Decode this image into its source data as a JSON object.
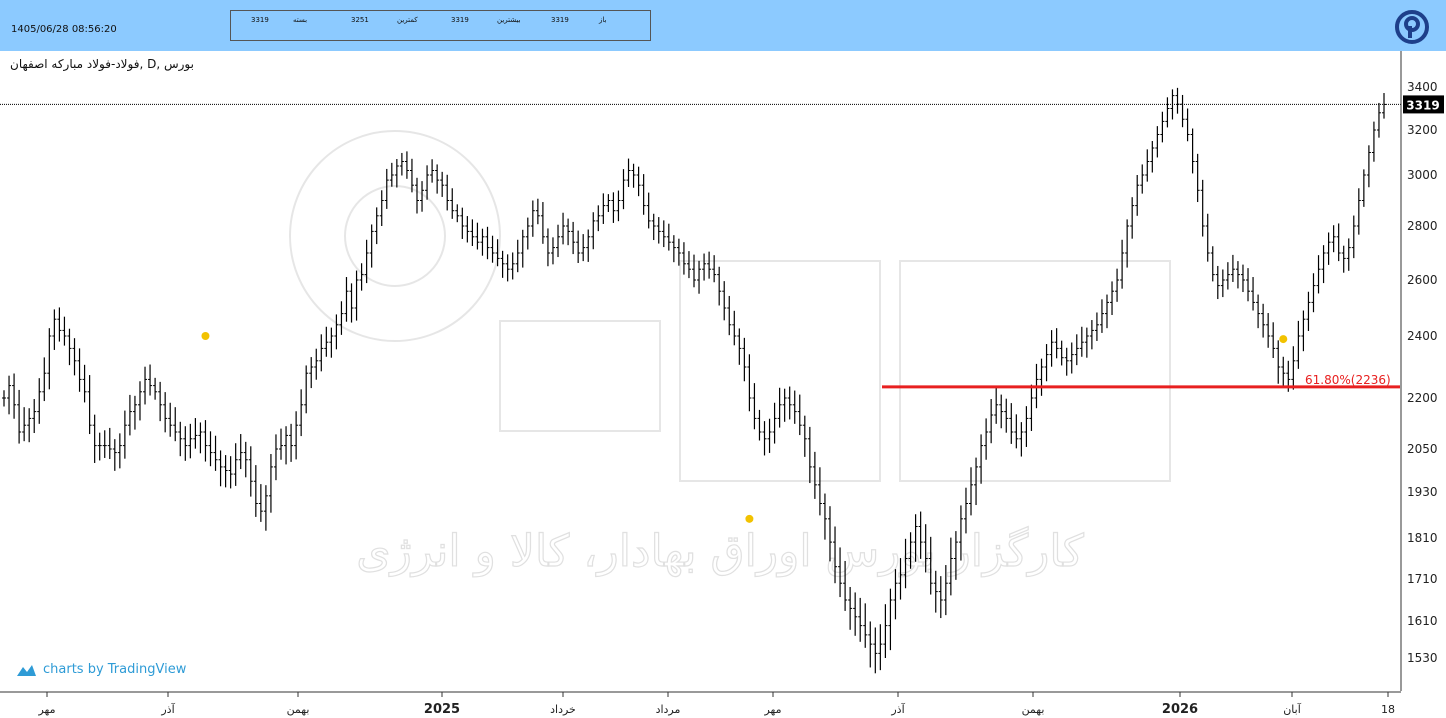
{
  "header": {
    "datetime": "1405/06/28 08:56:20",
    "info": [
      {
        "label": "باز",
        "value": "3319"
      },
      {
        "label": "بیشترین",
        "value": "3319"
      },
      {
        "label": "کمترین",
        "value": "3251"
      },
      {
        "label": "بسته",
        "value": "3319"
      }
    ]
  },
  "symbol_title": "فولاد-فولاد مبارکه اصفهان, D, بورس",
  "branding": {
    "tradingview": "charts by TradingView"
  },
  "watermark_text": "کارگزار بورس اوراق بهادار، کالا و انرژی",
  "colors": {
    "header_bg": "#8ccaff",
    "bars": "#000000",
    "hline": "#e82020",
    "marker": "#f2c200",
    "last_price_bg": "#000000",
    "brand": "#2e9bd6",
    "logo": "#1e3f8a"
  },
  "chart_data": {
    "type": "bar",
    "subtype": "ohlc",
    "y_ticks": [
      1530,
      1610,
      1710,
      1810,
      1930,
      2050,
      2200,
      2400,
      2600,
      2800,
      3000,
      3200,
      3400
    ],
    "x_ticks": [
      "مهر",
      "آذر",
      "بهمن",
      "2025",
      "خرداد",
      "مرداد",
      "مهر",
      "آذر",
      "بهمن",
      "2026",
      "آبان",
      "18"
    ],
    "last_price": 3319,
    "horizontal_line": {
      "value": 2236,
      "label": "61.80%(2236)"
    },
    "markers": [
      2400,
      1860,
      2390
    ],
    "series": [
      {
        "values": [
          2200,
          2240,
          2180,
          2100,
          2120,
          2140,
          2160,
          2220,
          2280,
          2400,
          2460,
          2420,
          2400,
          2360,
          2320,
          2260,
          2220,
          2120,
          2060,
          2060,
          2060,
          2050,
          2040,
          2060,
          2120,
          2160,
          2180,
          2220,
          2260,
          2240,
          2220,
          2180,
          2140,
          2120,
          2100,
          2080,
          2060,
          2080,
          2090,
          2100,
          2060,
          2040,
          2020,
          2000,
          1990,
          1980,
          2020,
          2040,
          2020,
          1960,
          1900,
          1880,
          1920,
          2000,
          2050,
          2060,
          2090,
          2060,
          2120,
          2180,
          2280,
          2300,
          2320,
          2360,
          2380,
          2400,
          2440,
          2480,
          2560,
          2500,
          2600,
          2620,
          2700,
          2780,
          2840,
          2900,
          2980,
          3000,
          3040,
          3060,
          3020,
          2960,
          2900,
          2940,
          3000,
          3020,
          2980,
          2960,
          2900,
          2860,
          2840,
          2800,
          2780,
          2760,
          2740,
          2760,
          2720,
          2700,
          2680,
          2660,
          2640,
          2660,
          2700,
          2760,
          2800,
          2860,
          2840,
          2760,
          2700,
          2720,
          2760,
          2800,
          2780,
          2740,
          2700,
          2720,
          2760,
          2820,
          2840,
          2880,
          2900,
          2860,
          2900,
          2980,
          3020,
          3000,
          2960,
          2880,
          2820,
          2800,
          2780,
          2760,
          2740,
          2720,
          2700,
          2660,
          2640,
          2600,
          2640,
          2660,
          2640,
          2620,
          2560,
          2500,
          2440,
          2400,
          2360,
          2300,
          2200,
          2140,
          2100,
          2080,
          2100,
          2140,
          2180,
          2200,
          2180,
          2160,
          2120,
          2080,
          2000,
          1950,
          1900,
          1860,
          1800,
          1740,
          1700,
          1660,
          1640,
          1620,
          1600,
          1580,
          1560,
          1540,
          1560,
          1600,
          1660,
          1700,
          1720,
          1760,
          1800,
          1840,
          1800,
          1760,
          1700,
          1680,
          1660,
          1700,
          1760,
          1800,
          1860,
          1900,
          1950,
          2000,
          2060,
          2100,
          2150,
          2180,
          2160,
          2140,
          2100,
          2080,
          2100,
          2140,
          2200,
          2260,
          2300,
          2340,
          2380,
          2360,
          2330,
          2320,
          2340,
          2360,
          2380,
          2400,
          2420,
          2440,
          2480,
          2520,
          2560,
          2600,
          2700,
          2800,
          2880,
          2960,
          3000,
          3060,
          3120,
          3180,
          3240,
          3300,
          3360,
          3320,
          3250,
          3180,
          3060,
          2940,
          2800,
          2700,
          2620,
          2580,
          2600,
          2620,
          2640,
          2620,
          2600,
          2560,
          2520,
          2480,
          2440,
          2400,
          2360,
          2300,
          2280,
          2260,
          2320,
          2400,
          2460,
          2520,
          2580,
          2640,
          2700,
          2740,
          2760,
          2700,
          2680,
          2720,
          2800,
          2900,
          3000,
          3100,
          3200,
          3280,
          3319
        ]
      }
    ]
  }
}
